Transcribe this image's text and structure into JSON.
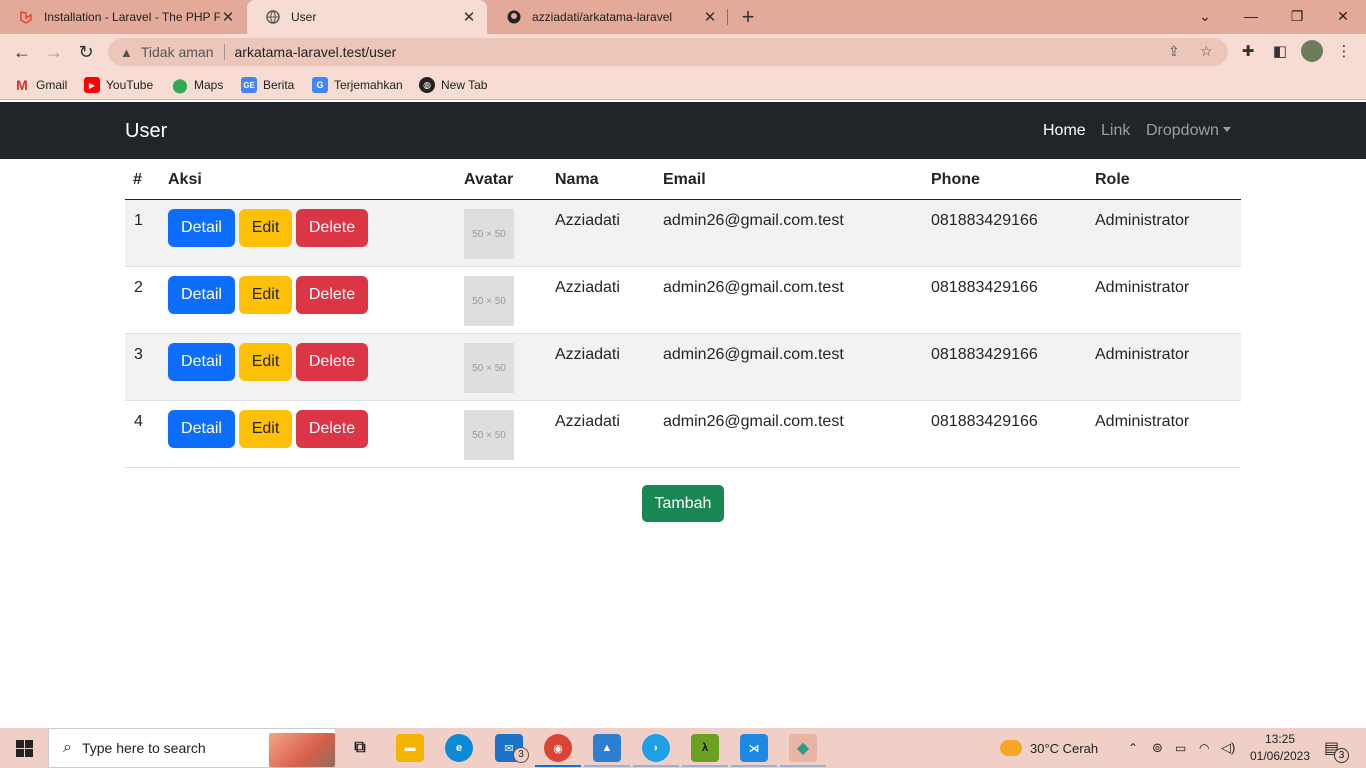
{
  "browser": {
    "tabs": [
      {
        "title": "Installation - Laravel - The PHP Fr",
        "icon": "laravel-icon"
      },
      {
        "title": "User",
        "icon": "globe-icon"
      },
      {
        "title": "azziadati/arkatama-laravel",
        "icon": "github-icon"
      }
    ],
    "omnibox": {
      "security": "Tidak aman",
      "url": "arkatama-laravel.test/user"
    },
    "bookmarks": [
      "Gmail",
      "YouTube",
      "Maps",
      "Berita",
      "Terjemahkan",
      "New Tab"
    ]
  },
  "navbar": {
    "brand": "User",
    "links": [
      "Home",
      "Link",
      "Dropdown"
    ]
  },
  "table": {
    "headers": [
      "#",
      "Aksi",
      "Avatar",
      "Nama",
      "Email",
      "Phone",
      "Role"
    ],
    "rows": [
      {
        "no": "1",
        "avatar": "50 × 50",
        "nama": "Azziadati",
        "email": "admin26@gmail.com.test",
        "phone": "081883429166",
        "role": "Administrator"
      },
      {
        "no": "2",
        "avatar": "50 × 50",
        "nama": "Azziadati",
        "email": "admin26@gmail.com.test",
        "phone": "081883429166",
        "role": "Administrator"
      },
      {
        "no": "3",
        "avatar": "50 × 50",
        "nama": "Azziadati",
        "email": "admin26@gmail.com.test",
        "phone": "081883429166",
        "role": "Administrator"
      },
      {
        "no": "4",
        "avatar": "50 × 50",
        "nama": "Azziadati",
        "email": "admin26@gmail.com.test",
        "phone": "081883429166",
        "role": "Administrator"
      }
    ],
    "actions": {
      "detail": "Detail",
      "edit": "Edit",
      "delete": "Delete"
    }
  },
  "add_button": "Tambah",
  "taskbar": {
    "search_placeholder": "Type here to search",
    "weather": "30°C  Cerah",
    "time": "13:25",
    "date": "01/06/2023",
    "mail_badge": "3",
    "notif_badge": "3"
  },
  "colors": {
    "primary": "#0d6efd",
    "warning": "#ffc107",
    "danger": "#dc3545",
    "success": "#198754",
    "navbar": "#212529"
  }
}
